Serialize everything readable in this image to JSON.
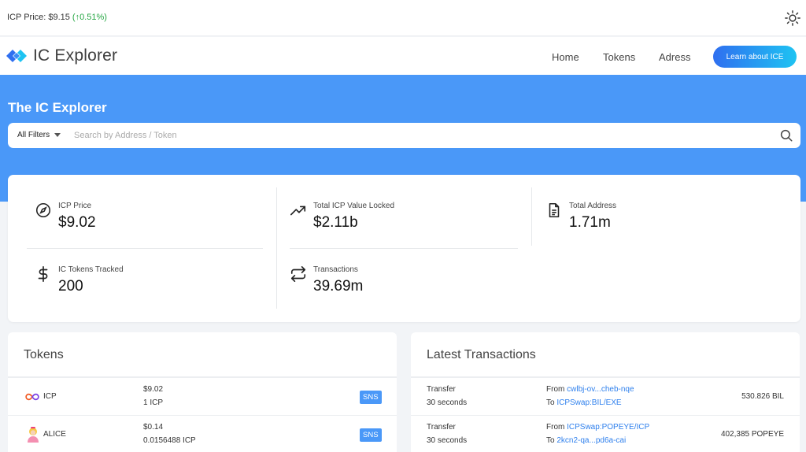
{
  "topbar": {
    "price_label": "ICP Price: $9.15",
    "price_change": "(↑0.51%)",
    "theme_icon": "sun-icon"
  },
  "navbar": {
    "logo_text": "IC Explorer",
    "links": [
      "Home",
      "Tokens",
      "Adress"
    ],
    "cta_label": "Learn about ICE"
  },
  "hero": {
    "title": "The IC Explorer",
    "filter_label": "All Filters",
    "search_placeholder": "Search by Address / Token"
  },
  "stats": [
    {
      "label": "ICP Price",
      "value": "$9.02",
      "icon": "compass-icon"
    },
    {
      "label": "Total ICP Value Locked",
      "value": "$2.11b",
      "icon": "trending-up-icon"
    },
    {
      "label": "Total Address",
      "value": "1.71m",
      "icon": "document-icon"
    },
    {
      "label": "IC Tokens Tracked",
      "value": "200",
      "icon": "dollar-icon"
    },
    {
      "label": "Transactions",
      "value": "39.69m",
      "icon": "repeat-icon"
    }
  ],
  "tokens_panel": {
    "title": "Tokens",
    "rows": [
      {
        "name": "ICP",
        "price": "$9.02",
        "rate": "1 ICP",
        "badge": "SNS",
        "icon": "icp-infinity-icon"
      },
      {
        "name": "ALICE",
        "price": "$0.14",
        "rate": "0.0156488 ICP",
        "badge": "SNS",
        "icon": "alice-avatar-icon"
      }
    ]
  },
  "transactions_panel": {
    "title": "Latest Transactions",
    "rows": [
      {
        "type": "Transfer",
        "time": "30 seconds",
        "from_label": "From",
        "from": "cwlbj-ov...cheb-nqe",
        "to_label": "To",
        "to": "ICPSwap:BIL/EXE",
        "amount": "530.826 BIL"
      },
      {
        "type": "Transfer",
        "time": "30 seconds",
        "from_label": "From",
        "from": "ICPSwap:POPEYE/ICP",
        "to_label": "To",
        "to": "2kcn2-qa...pd6a-cai",
        "amount": "402,385 POPEYE"
      }
    ]
  },
  "colors": {
    "hero_blue": "#4a98f8",
    "link_blue": "#2f80ed",
    "positive_green": "#27a745",
    "cta_gradient_start": "#2f6ff0",
    "cta_gradient_end": "#1ec3f2"
  }
}
